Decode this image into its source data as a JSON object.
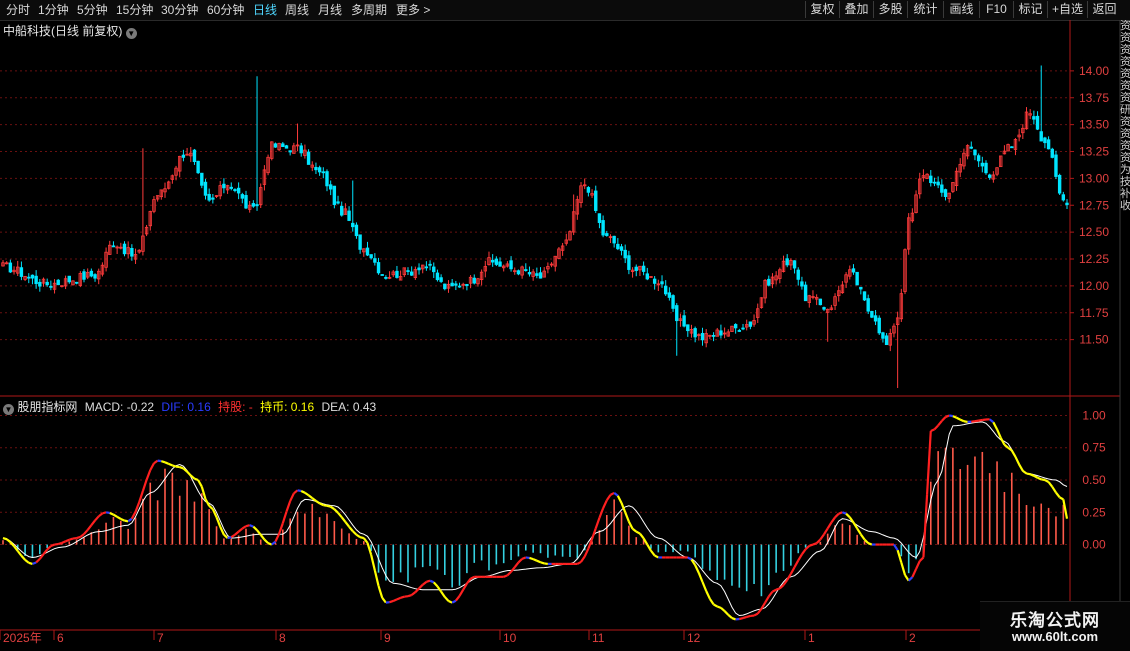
{
  "toolbar": {
    "periods": [
      "分时",
      "1分钟",
      "5分钟",
      "15分钟",
      "30分钟",
      "60分钟",
      "日线",
      "周线",
      "月线",
      "多周期",
      "更多 >"
    ],
    "active_period": "日线",
    "right_buttons": [
      "复权",
      "叠加",
      "多股",
      "统计",
      "画线",
      "F10",
      "标记",
      "+自选",
      "返回"
    ]
  },
  "main_title": "中船科技(日线 前复权)",
  "indicator": {
    "name": "股朋指标网",
    "macd_label": "MACD: -0.22",
    "dif_label": "DIF: 0.16",
    "hold_label": "持股: -",
    "coin_label": "持币: 0.16",
    "dea_label": "DEA: 0.43",
    "colors": {
      "macd": "#dddddd",
      "dif": "#2a3cff",
      "hold": "#ff3030",
      "coin": "#ffff00",
      "dea": "#dddddd"
    }
  },
  "right_strip_text": "资资资资资资资研资资资资为技补收",
  "watermark": {
    "line1": "乐淘公式网",
    "line2": "www.60lt.com"
  },
  "colors": {
    "up": "#ff3b3b",
    "down": "#00e5ff",
    "grid": "#6a1010",
    "axis": "#b01818",
    "bg": "#000000",
    "dea": "#ffffff",
    "yellow": "#ffff00",
    "red": "#ff2020",
    "blue": "#3040ff"
  },
  "chart_data": [
    {
      "type": "candlestick",
      "title": "中船科技(日线 前复权)",
      "x_range": [
        "2025年",
        "2"
      ],
      "x_tick_labels": [
        "2025年",
        "6",
        "7",
        "8",
        "9",
        "10",
        "11",
        "12",
        "1",
        "2"
      ],
      "y_ticks": [
        11.5,
        11.75,
        12.0,
        12.25,
        12.5,
        12.75,
        13.0,
        13.25,
        13.5,
        13.75,
        14.0
      ],
      "ylim": [
        11.05,
        14.25
      ],
      "close_anchors": [
        [
          0,
          12.18
        ],
        [
          12,
          12.02
        ],
        [
          25,
          12.1
        ],
        [
          30,
          12.4
        ],
        [
          36,
          12.28
        ],
        [
          42,
          12.85
        ],
        [
          50,
          13.25
        ],
        [
          56,
          12.78
        ],
        [
          61,
          12.95
        ],
        [
          68,
          12.7
        ],
        [
          73,
          13.3
        ],
        [
          80,
          13.28
        ],
        [
          86,
          13.05
        ],
        [
          92,
          12.7
        ],
        [
          98,
          12.35
        ],
        [
          104,
          12.1
        ],
        [
          110,
          12.13
        ],
        [
          114,
          12.2
        ],
        [
          121,
          11.98
        ],
        [
          127,
          12.05
        ],
        [
          132,
          12.22
        ],
        [
          140,
          12.15
        ],
        [
          146,
          12.08
        ],
        [
          152,
          12.35
        ],
        [
          158,
          12.95
        ],
        [
          164,
          12.45
        ],
        [
          172,
          12.15
        ],
        [
          178,
          12.05
        ],
        [
          184,
          11.65
        ],
        [
          190,
          11.52
        ],
        [
          196,
          11.58
        ],
        [
          203,
          11.65
        ],
        [
          208,
          12.05
        ],
        [
          214,
          12.25
        ],
        [
          218,
          11.9
        ],
        [
          224,
          11.8
        ],
        [
          230,
          12.12
        ],
        [
          236,
          11.75
        ],
        [
          240,
          11.45
        ],
        [
          243,
          11.72
        ],
        [
          246,
          12.6
        ],
        [
          250,
          13.05
        ],
        [
          256,
          12.85
        ],
        [
          262,
          13.28
        ],
        [
          268,
          13.05
        ],
        [
          274,
          13.3
        ],
        [
          279,
          13.62
        ],
        [
          283,
          13.35
        ],
        [
          288,
          12.8
        ]
      ],
      "volatility": 0.09,
      "spikes": [
        [
          38,
          13.28,
          "wick"
        ],
        [
          69,
          13.95,
          "wick"
        ],
        [
          80,
          13.51,
          "wick"
        ],
        [
          95,
          12.98,
          "wick"
        ],
        [
          155,
          12.85,
          "wick"
        ],
        [
          183,
          11.35,
          "wick"
        ],
        [
          224,
          11.48,
          "wick"
        ],
        [
          243,
          11.05,
          "wick"
        ],
        [
          282,
          14.05,
          "wick"
        ]
      ]
    },
    {
      "type": "line",
      "title": "股朋指标网",
      "y_ticks": [
        0.0,
        0.25,
        0.5,
        0.75,
        1.0
      ],
      "ylim": [
        -0.6,
        1.05
      ],
      "series_dif_anchors": [
        [
          0,
          0.05
        ],
        [
          8,
          -0.15
        ],
        [
          14,
          0.0
        ],
        [
          20,
          0.05
        ],
        [
          28,
          0.25
        ],
        [
          34,
          0.18
        ],
        [
          42,
          0.65
        ],
        [
          48,
          0.6
        ],
        [
          53,
          0.5
        ],
        [
          56,
          0.3
        ],
        [
          61,
          0.05
        ],
        [
          67,
          0.15
        ],
        [
          73,
          0.0
        ],
        [
          80,
          0.42
        ],
        [
          88,
          0.3
        ],
        [
          98,
          0.05
        ],
        [
          104,
          -0.45
        ],
        [
          110,
          -0.4
        ],
        [
          116,
          -0.28
        ],
        [
          122,
          -0.45
        ],
        [
          128,
          -0.25
        ],
        [
          136,
          -0.25
        ],
        [
          142,
          -0.1
        ],
        [
          148,
          -0.15
        ],
        [
          156,
          -0.15
        ],
        [
          166,
          0.4
        ],
        [
          172,
          0.1
        ],
        [
          178,
          -0.1
        ],
        [
          186,
          -0.1
        ],
        [
          194,
          -0.48
        ],
        [
          199,
          -0.58
        ],
        [
          204,
          -0.55
        ],
        [
          210,
          -0.35
        ],
        [
          220,
          0.0
        ],
        [
          228,
          0.25
        ],
        [
          236,
          0.0
        ],
        [
          242,
          0.0
        ],
        [
          246,
          -0.28
        ],
        [
          250,
          -0.1
        ],
        [
          252,
          0.88
        ],
        [
          257,
          1.0
        ],
        [
          262,
          0.95
        ],
        [
          268,
          0.97
        ],
        [
          273,
          0.75
        ],
        [
          278,
          0.55
        ],
        [
          283,
          0.5
        ],
        [
          288,
          0.35
        ],
        [
          289,
          0.2
        ]
      ],
      "series_dea_anchors": [
        [
          0,
          0.05
        ],
        [
          8,
          -0.1
        ],
        [
          16,
          -0.02
        ],
        [
          26,
          0.1
        ],
        [
          34,
          0.15
        ],
        [
          40,
          0.4
        ],
        [
          48,
          0.62
        ],
        [
          56,
          0.32
        ],
        [
          62,
          0.05
        ],
        [
          70,
          0.08
        ],
        [
          76,
          0.08
        ],
        [
          82,
          0.35
        ],
        [
          90,
          0.3
        ],
        [
          98,
          0.08
        ],
        [
          106,
          -0.3
        ],
        [
          114,
          -0.35
        ],
        [
          122,
          -0.35
        ],
        [
          130,
          -0.25
        ],
        [
          138,
          -0.2
        ],
        [
          146,
          -0.18
        ],
        [
          154,
          -0.15
        ],
        [
          162,
          0.1
        ],
        [
          170,
          0.3
        ],
        [
          178,
          0.05
        ],
        [
          186,
          -0.1
        ],
        [
          194,
          -0.3
        ],
        [
          200,
          -0.55
        ],
        [
          206,
          -0.5
        ],
        [
          214,
          -0.25
        ],
        [
          222,
          -0.05
        ],
        [
          228,
          0.2
        ],
        [
          236,
          0.1
        ],
        [
          242,
          0.05
        ],
        [
          248,
          -0.1
        ],
        [
          254,
          0.5
        ],
        [
          258,
          0.92
        ],
        [
          266,
          0.95
        ],
        [
          272,
          0.8
        ],
        [
          278,
          0.55
        ],
        [
          286,
          0.5
        ],
        [
          289,
          0.45
        ]
      ],
      "series_macd_bars_note": "bars = 2*(DIF-DEA) clipped, red >0 cyan <0",
      "legend": [
        "MACD: -0.22",
        "DIF: 0.16",
        "持股: -",
        "持币: 0.16",
        "DEA: 0.43"
      ]
    }
  ]
}
